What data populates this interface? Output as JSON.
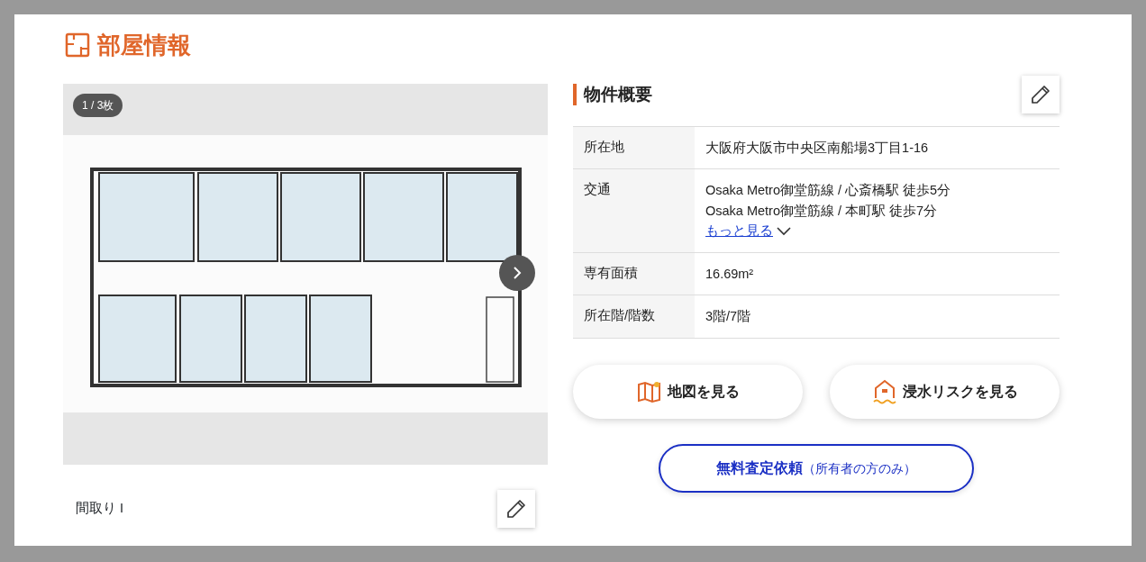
{
  "section_title": "部屋情報",
  "gallery": {
    "counter": "1 / 3枚",
    "caption": "間取り I"
  },
  "overview": {
    "title": "物件概要",
    "rows": [
      {
        "label": "所在地",
        "lines": [
          "大阪府大阪市中央区南船場3丁目1-16"
        ]
      },
      {
        "label": "交通",
        "lines": [
          "Osaka Metro御堂筋線 / 心斎橋駅 徒歩5分",
          "Osaka Metro御堂筋線 / 本町駅 徒歩7分"
        ],
        "more_link": "もっと見る"
      },
      {
        "label": "専有面積",
        "lines": [
          "16.69m²"
        ]
      },
      {
        "label": "所在階/階数",
        "lines": [
          "3階/7階"
        ]
      }
    ]
  },
  "buttons": [
    {
      "label": "地図を見る",
      "kind": "map"
    },
    {
      "label": "浸水リスクを見る",
      "kind": "flood"
    }
  ],
  "assessment_button": {
    "label": "無料査定依頼",
    "note": "（所有者の方のみ）"
  }
}
